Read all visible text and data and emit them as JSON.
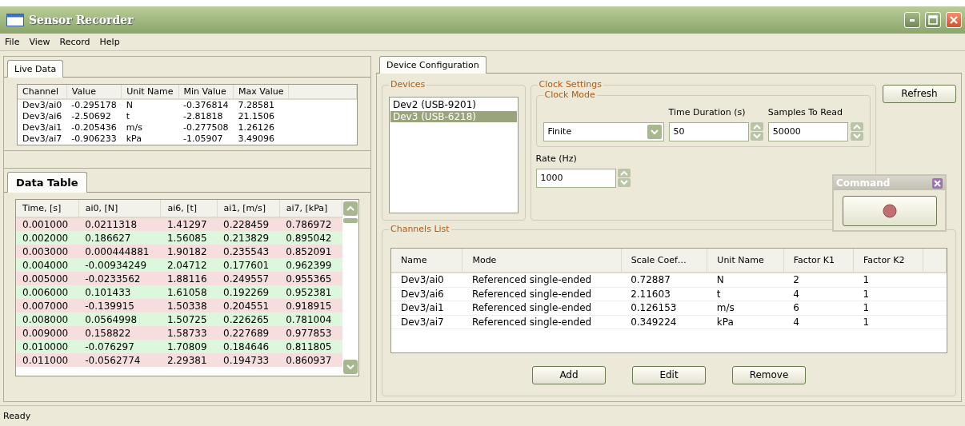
{
  "window": {
    "title": "Sensor Recorder"
  },
  "menu": [
    "File",
    "View",
    "Record",
    "Help"
  ],
  "live_data": {
    "tab": "Live Data",
    "columns": [
      "Channel",
      "Value",
      "Unit Name",
      "Min Value",
      "Max Value"
    ],
    "rows": [
      [
        "Dev3/ai0",
        "-0.295178",
        "N",
        "-0.376814",
        "7.28581"
      ],
      [
        "Dev3/ai6",
        "-2.50692",
        "t",
        "-2.81818",
        "21.1506"
      ],
      [
        "Dev3/ai1",
        "-0.205436",
        "m/s",
        "-0.277508",
        "1.26126"
      ],
      [
        "Dev3/ai7",
        "-0.906233",
        "kPa",
        "-1.05907",
        "3.49096"
      ]
    ]
  },
  "data_table": {
    "tab": "Data Table",
    "columns": [
      "Time, [s]",
      "ai0, [N]",
      "ai6, [t]",
      "ai1, [m/s]",
      "ai7, [kPa]"
    ],
    "rows": [
      {
        "color": "#f7dede",
        "cells": [
          "0.001000",
          "0.0211318",
          "1.41297",
          "0.228459",
          "0.786972"
        ]
      },
      {
        "color": "#dcf7dc",
        "cells": [
          "0.002000",
          "0.186627",
          "1.56085",
          "0.213829",
          "0.895042"
        ]
      },
      {
        "color": "#f7dede",
        "cells": [
          "0.003000",
          "0.000444881",
          "1.90182",
          "0.235543",
          "0.852091"
        ]
      },
      {
        "color": "#dcf7dc",
        "cells": [
          "0.004000",
          "-0.00934249",
          "2.04712",
          "0.177601",
          "0.962399"
        ]
      },
      {
        "color": "#f7dede",
        "cells": [
          "0.005000",
          "-0.0233562",
          "1.88116",
          "0.249557",
          "0.955365"
        ]
      },
      {
        "color": "#dcf7dc",
        "cells": [
          "0.006000",
          "0.101433",
          "1.61058",
          "0.192269",
          "0.952381"
        ]
      },
      {
        "color": "#f7dede",
        "cells": [
          "0.007000",
          "-0.139915",
          "1.50338",
          "0.204551",
          "0.918915"
        ]
      },
      {
        "color": "#dcf7dc",
        "cells": [
          "0.008000",
          "0.0564998",
          "1.50725",
          "0.226265",
          "0.781004"
        ]
      },
      {
        "color": "#f7dede",
        "cells": [
          "0.009000",
          "0.158822",
          "1.58733",
          "0.227689",
          "0.977853"
        ]
      },
      {
        "color": "#dcf7dc",
        "cells": [
          "0.010000",
          "-0.076297",
          "1.70809",
          "0.184646",
          "0.811805"
        ]
      },
      {
        "color": "#f7dede",
        "cells": [
          "0.011000",
          "-0.0562774",
          "2.29381",
          "0.194733",
          "0.860937"
        ]
      }
    ]
  },
  "device_configuration": {
    "tab": "Device Configuration",
    "devices": {
      "label": "Devices",
      "items": [
        {
          "text": "Dev2 (USB-9201)",
          "selected": false
        },
        {
          "text": "Dev3 (USB-6218)",
          "selected": true
        }
      ]
    },
    "clock_settings": {
      "label": "Clock Settings",
      "clock_mode": {
        "label": "Clock Mode",
        "value": "Finite"
      },
      "time_duration": {
        "label": "Time Duration (s)",
        "value": "50"
      },
      "samples_to_read": {
        "label": "Samples To Read",
        "value": "50000"
      },
      "rate": {
        "label": "Rate (Hz)",
        "value": "1000"
      }
    },
    "refresh_button": "Refresh",
    "channels_list": {
      "label": "Channels List",
      "columns": [
        "Name",
        "Mode",
        "Scale Coef…",
        "Unit Name",
        "Factor K1",
        "Factor K2"
      ],
      "rows": [
        [
          "Dev3/ai0",
          "Referenced single-ended",
          "0.72887",
          "N",
          "2",
          "1"
        ],
        [
          "Dev3/ai6",
          "Referenced single-ended",
          "2.11603",
          "t",
          "4",
          "1"
        ],
        [
          "Dev3/ai1",
          "Referenced single-ended",
          "0.126153",
          "m/s",
          "6",
          "1"
        ],
        [
          "Dev3/ai7",
          "Referenced single-ended",
          "0.349224",
          "kPa",
          "4",
          "1"
        ]
      ]
    },
    "buttons": [
      "Add",
      "Edit",
      "Remove"
    ]
  },
  "command_window": {
    "title": "Command"
  },
  "status_bar": "Ready"
}
